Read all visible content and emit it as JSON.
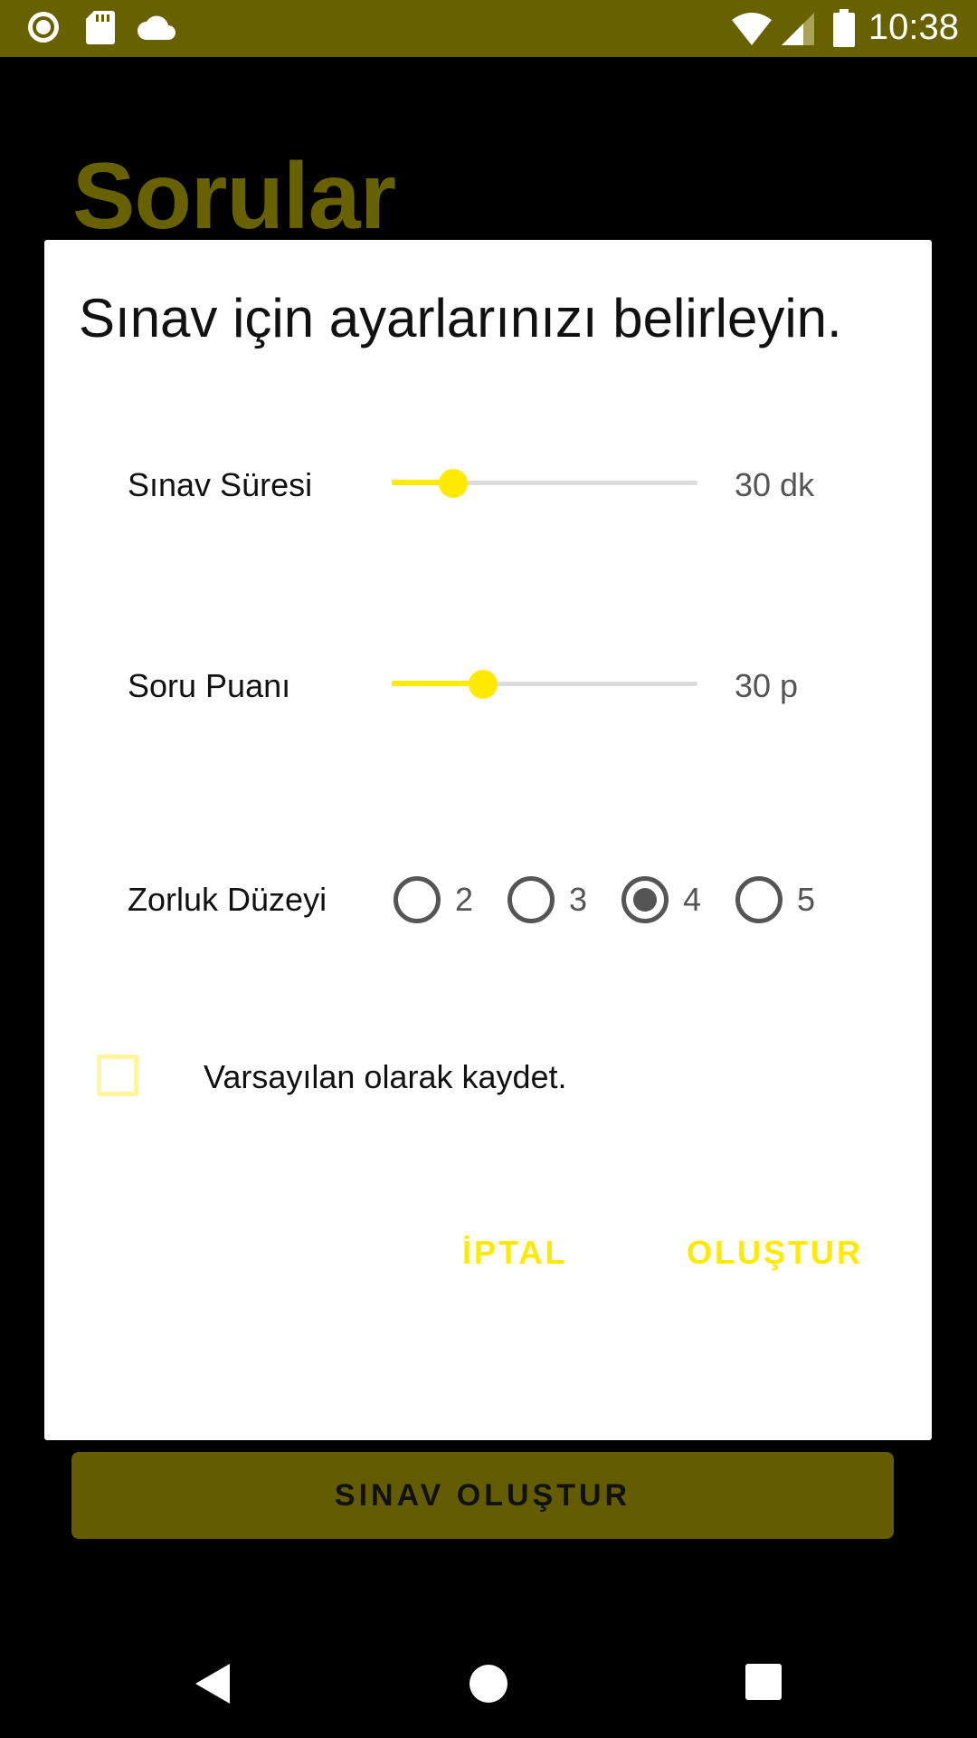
{
  "status_bar": {
    "time": "10:38",
    "icons": [
      "record-icon",
      "sd-card-icon",
      "cloud-icon",
      "wifi-icon",
      "signal-icon",
      "battery-icon"
    ]
  },
  "app": {
    "title": "Sorular",
    "create_button_label": "SINAV OLUŞTUR"
  },
  "dialog": {
    "title": "Sınav için ayarlarınızı belirleyin.",
    "duration": {
      "label": "Sınav Süresi",
      "value_text": "30 dk",
      "fraction": 0.2
    },
    "score": {
      "label": "Soru Puanı",
      "value_text": "30 p",
      "fraction": 0.3
    },
    "difficulty": {
      "label": "Zorluk Düzeyi",
      "options": [
        "2",
        "3",
        "4",
        "5"
      ],
      "selected": "4"
    },
    "save_default_label": "Varsayılan olarak kaydet.",
    "save_default_checked": false,
    "cancel_label": "İPTAL",
    "create_label": "OLUŞTUR"
  },
  "colors": {
    "status_bar": "#686100",
    "accent": "#ffea00",
    "app_title": "#686100",
    "app_button": "#645c00"
  },
  "nav_bar": {
    "icons": [
      "back-icon",
      "home-icon",
      "recents-icon"
    ]
  }
}
